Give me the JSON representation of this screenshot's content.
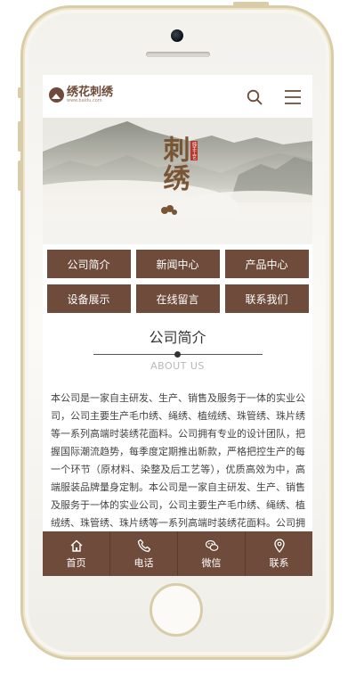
{
  "site": {
    "name": "绣花刺绣",
    "url": "www.baidu.com"
  },
  "header": {
    "icons": [
      "search-icon",
      "menu-icon"
    ]
  },
  "banner": {
    "title": "刺绣",
    "seal": "纯手工艺"
  },
  "nav": [
    {
      "label": "公司简介"
    },
    {
      "label": "新闻中心"
    },
    {
      "label": "产品中心"
    },
    {
      "label": "设备展示"
    },
    {
      "label": "在线留言"
    },
    {
      "label": "联系我们"
    }
  ],
  "about": {
    "title": "公司简介",
    "subtitle": "ABOUT US",
    "body": "本公司是一家自主研发、生产、销售及服务于一体的实业公司，公司主要生产毛巾绣、绳绣、植绒绣、珠管绣、珠片绣等一系列高端时装绣花面料。公司拥有专业的设计团队，把握国际潮流趋势，每季度定期推出新款，严格把控生产的每一个环节（原材料、染整及后工艺等），优质高效为中，高端服装品牌量身定制。本公司是一家自主研发、生产、销售及服务于一体的实业公司，公司主要生产毛巾绣、绳绣、植绒绣、珠管绣、珠片绣等一系列高端时装绣花面料。公司拥有专业的设计团队，把握国际潮流趋势，每季度定期推出新款，严格把控生产的每一个环节（原材料、染整及后工艺等），优质高效为中，高端服装品牌量身定制。"
  },
  "footer": [
    {
      "label": "首页",
      "icon": "home-icon"
    },
    {
      "label": "电话",
      "icon": "phone-icon"
    },
    {
      "label": "微信",
      "icon": "wechat-icon"
    },
    {
      "label": "联系",
      "icon": "location-icon"
    }
  ],
  "colors": {
    "brand": "#6e4b3a",
    "accent_gold": "#7a5533",
    "seal_red": "#b5382e",
    "phone_frame": "#d8cda8"
  }
}
